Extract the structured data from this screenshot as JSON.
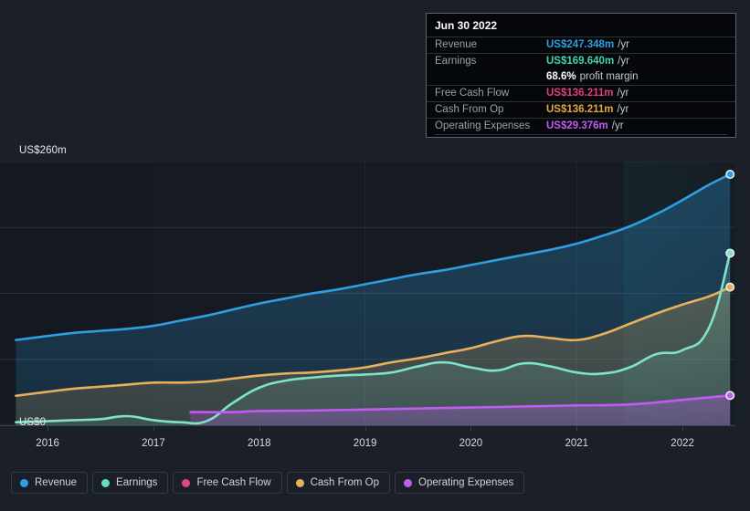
{
  "chart_data": {
    "type": "area",
    "title": "",
    "xlabel": "",
    "ylabel": "",
    "ylim": [
      0,
      260
    ],
    "xlim": [
      2015.55,
      2022.5
    ],
    "grid": true,
    "legend_position": "bottom-left",
    "y_axis": {
      "top_label": "US$260m",
      "zero_label": "US$0",
      "top_value": 260,
      "zero_value": 0,
      "gridline_values": [
        260,
        195,
        130,
        65,
        0
      ]
    },
    "x_axis": {
      "tick_labels": [
        "2016",
        "2017",
        "2018",
        "2019",
        "2020",
        "2021",
        "2022"
      ],
      "tick_values": [
        2016,
        2017,
        2018,
        2019,
        2020,
        2021,
        2022
      ]
    },
    "forecast_start": 2021.45,
    "series": [
      {
        "name": "Revenue",
        "color": "#2e9fe0",
        "x": [
          2015.7,
          2016.0,
          2016.25,
          2016.5,
          2016.75,
          2017.0,
          2017.25,
          2017.5,
          2017.75,
          2018.0,
          2018.25,
          2018.5,
          2018.75,
          2019.0,
          2019.25,
          2019.5,
          2019.75,
          2020.0,
          2020.25,
          2020.5,
          2020.75,
          2021.0,
          2021.25,
          2021.5,
          2021.75,
          2022.0,
          2022.25,
          2022.45
        ],
        "values": [
          84,
          88,
          91,
          93,
          95,
          98,
          103,
          108,
          114,
          120,
          125,
          130,
          134,
          139,
          144,
          149,
          153,
          158,
          163,
          168,
          173,
          179,
          187,
          196,
          208,
          222,
          237,
          247.348
        ]
      },
      {
        "name": "Earnings",
        "color": "#7fe3c8",
        "x": [
          2015.7,
          2016.0,
          2016.25,
          2016.5,
          2016.75,
          2017.0,
          2017.25,
          2017.5,
          2017.75,
          2018.0,
          2018.25,
          2018.5,
          2018.75,
          2019.0,
          2019.25,
          2019.5,
          2019.75,
          2020.0,
          2020.25,
          2020.5,
          2020.75,
          2021.0,
          2021.25,
          2021.5,
          2021.75,
          2022.0,
          2022.25,
          2022.45
        ],
        "values": [
          3,
          4,
          5,
          6,
          9,
          5,
          3,
          4,
          22,
          37,
          44,
          47,
          49,
          50,
          52,
          58,
          62,
          57,
          54,
          61,
          58,
          52,
          51,
          57,
          70,
          74,
          96,
          169.64
        ]
      },
      {
        "name": "Free Cash Flow",
        "color": "#d94b7e",
        "x": [
          2015.7,
          2022.45
        ],
        "values": [
          null,
          136.211
        ]
      },
      {
        "name": "Cash From Op",
        "color": "#e8b05c",
        "x": [
          2015.7,
          2016.0,
          2016.25,
          2016.5,
          2016.75,
          2017.0,
          2017.25,
          2017.5,
          2017.75,
          2018.0,
          2018.25,
          2018.5,
          2018.75,
          2019.0,
          2019.25,
          2019.5,
          2019.75,
          2020.0,
          2020.25,
          2020.5,
          2020.75,
          2021.0,
          2021.25,
          2021.5,
          2021.75,
          2022.0,
          2022.25,
          2022.45
        ],
        "values": [
          29,
          33,
          36,
          38,
          40,
          42,
          42,
          43,
          46,
          49,
          51,
          52,
          54,
          57,
          62,
          66,
          71,
          76,
          83,
          88,
          86,
          84,
          90,
          100,
          110,
          119,
          127,
          136.211
        ]
      },
      {
        "name": "Operating Expenses",
        "color": "#c25bf2",
        "x": [
          2017.35,
          2017.75,
          2018.0,
          2018.5,
          2019.0,
          2019.5,
          2020.0,
          2020.5,
          2021.0,
          2021.5,
          2022.0,
          2022.45
        ],
        "values": [
          13,
          13,
          14,
          14.5,
          15.5,
          16.5,
          17.5,
          18.5,
          19.5,
          20.5,
          25,
          29.376
        ]
      }
    ]
  },
  "tooltip": {
    "title": "Jun 30 2022",
    "rows": [
      {
        "label": "Revenue",
        "value": "US$247.348m",
        "unit": "/yr",
        "color": "#2e9fe0"
      },
      {
        "label": "Earnings",
        "value": "US$169.640m",
        "unit": "/yr",
        "color": "#3fd6b0"
      },
      {
        "label": "Free Cash Flow",
        "value": "US$136.211m",
        "unit": "/yr",
        "color": "#e0407a"
      },
      {
        "label": "Cash From Op",
        "value": "US$136.211m",
        "unit": "/yr",
        "color": "#e8a53c"
      },
      {
        "label": "Operating Expenses",
        "value": "US$29.376m",
        "unit": "/yr",
        "color": "#c25bf2"
      }
    ],
    "profit_margin_value": "68.6%",
    "profit_margin_text": "profit margin"
  },
  "legend": {
    "items": [
      {
        "label": "Revenue",
        "color": "#2e9fe0"
      },
      {
        "label": "Earnings",
        "color": "#5fe0c0"
      },
      {
        "label": "Free Cash Flow",
        "color": "#d94b7e"
      },
      {
        "label": "Cash From Op",
        "color": "#e8b05c"
      },
      {
        "label": "Operating Expenses",
        "color": "#c25bf2"
      }
    ]
  },
  "colors": {
    "page_background": "#1b2028",
    "plot_background": "#141820",
    "gridline": "#2b323c",
    "axis_text": "#d6dae2"
  }
}
